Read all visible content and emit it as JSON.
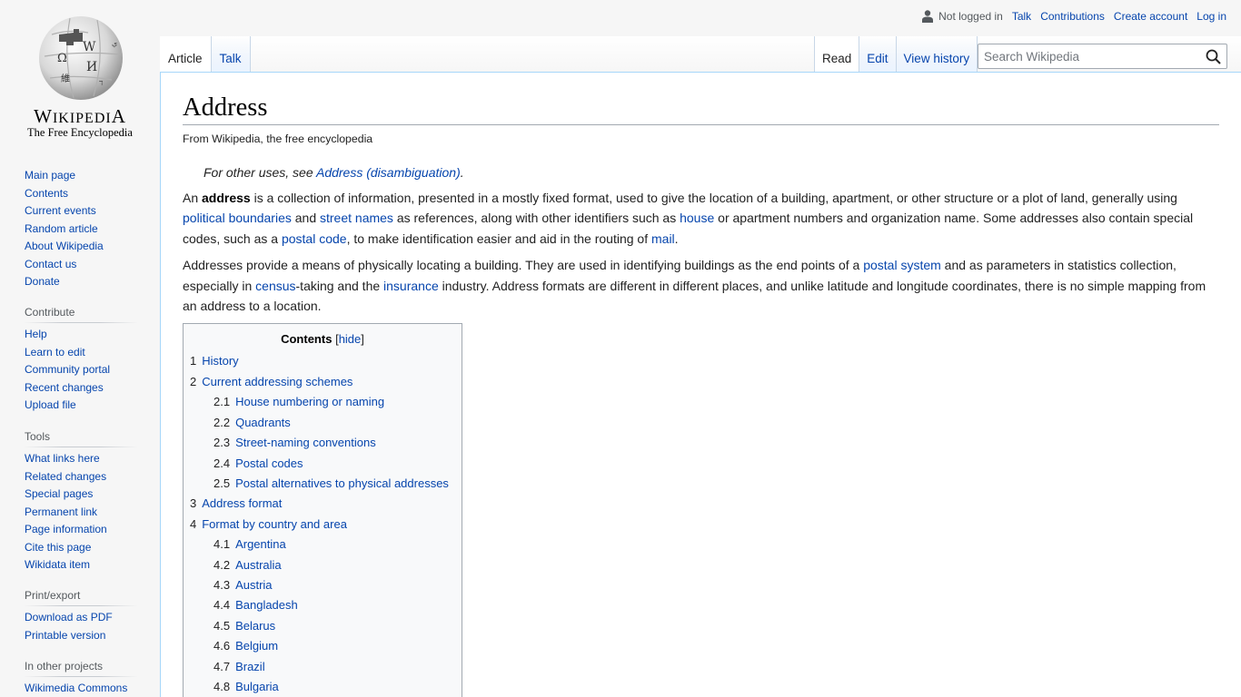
{
  "logo": {
    "wordmark_parts": [
      "W",
      "IKIPEDI",
      "A"
    ],
    "tagline": "The Free Encyclopedia"
  },
  "personal": {
    "status": "Not logged in",
    "links": [
      "Talk",
      "Contributions",
      "Create account",
      "Log in"
    ]
  },
  "tabs_left": [
    {
      "label": "Article",
      "selected": true
    },
    {
      "label": "Talk",
      "selected": false
    }
  ],
  "tabs_right": [
    {
      "label": "Read",
      "selected": true
    },
    {
      "label": "Edit",
      "selected": false
    },
    {
      "label": "View history",
      "selected": false
    }
  ],
  "search": {
    "placeholder": "Search Wikipedia",
    "value": ""
  },
  "sidebar": {
    "navigation": [
      "Main page",
      "Contents",
      "Current events",
      "Random article",
      "About Wikipedia",
      "Contact us",
      "Donate"
    ],
    "sections": [
      {
        "heading": "Contribute",
        "items": [
          "Help",
          "Learn to edit",
          "Community portal",
          "Recent changes",
          "Upload file"
        ]
      },
      {
        "heading": "Tools",
        "items": [
          "What links here",
          "Related changes",
          "Special pages",
          "Permanent link",
          "Page information",
          "Cite this page",
          "Wikidata item"
        ]
      },
      {
        "heading": "Print/export",
        "items": [
          "Download as PDF",
          "Printable version"
        ]
      },
      {
        "heading": "In other projects",
        "items": [
          "Wikimedia Commons"
        ]
      }
    ]
  },
  "article": {
    "title": "Address",
    "site_sub": "From Wikipedia, the free encyclopedia",
    "hatnote": {
      "prefix": "For other uses, see ",
      "link": "Address (disambiguation)",
      "suffix": "."
    },
    "p1": {
      "t0": "An ",
      "bold": "address",
      "t1": " is a collection of information, presented in a mostly fixed format, used to give the location of a building, apartment, or other structure or a plot of land, generally using ",
      "l1": "political boundaries",
      "t2": " and ",
      "l2": "street names",
      "t3": " as references, along with other identifiers such as ",
      "l3": "house",
      "t4": " or apartment numbers and organization name. Some addresses also contain special codes, such as a ",
      "l4": "postal code",
      "t5": ", to make identification easier and aid in the routing of ",
      "l5": "mail",
      "t6": "."
    },
    "p2": {
      "t0": "Addresses provide a means of physically locating a building. They are used in identifying buildings as the end points of a ",
      "l1": "postal system",
      "t1": " and as parameters in statistics collection, especially in ",
      "l2": "census",
      "t2": "-taking and the ",
      "l3": "insurance",
      "t3": " industry. Address formats are different in different places, and unlike latitude and longitude coordinates, there is no simple mapping from an address to a location."
    }
  },
  "toc": {
    "heading": "Contents",
    "toggle": "hide",
    "items": [
      {
        "num": "1",
        "label": "History",
        "level": 1
      },
      {
        "num": "2",
        "label": "Current addressing schemes",
        "level": 1
      },
      {
        "num": "2.1",
        "label": "House numbering or naming",
        "level": 2
      },
      {
        "num": "2.2",
        "label": "Quadrants",
        "level": 2
      },
      {
        "num": "2.3",
        "label": "Street-naming conventions",
        "level": 2
      },
      {
        "num": "2.4",
        "label": "Postal codes",
        "level": 2
      },
      {
        "num": "2.5",
        "label": "Postal alternatives to physical addresses",
        "level": 2
      },
      {
        "num": "3",
        "label": "Address format",
        "level": 1
      },
      {
        "num": "4",
        "label": "Format by country and area",
        "level": 1
      },
      {
        "num": "4.1",
        "label": "Argentina",
        "level": 2
      },
      {
        "num": "4.2",
        "label": "Australia",
        "level": 2
      },
      {
        "num": "4.3",
        "label": "Austria",
        "level": 2
      },
      {
        "num": "4.4",
        "label": "Bangladesh",
        "level": 2
      },
      {
        "num": "4.5",
        "label": "Belarus",
        "level": 2
      },
      {
        "num": "4.6",
        "label": "Belgium",
        "level": 2
      },
      {
        "num": "4.7",
        "label": "Brazil",
        "level": 2
      },
      {
        "num": "4.8",
        "label": "Bulgaria",
        "level": 2
      }
    ]
  }
}
